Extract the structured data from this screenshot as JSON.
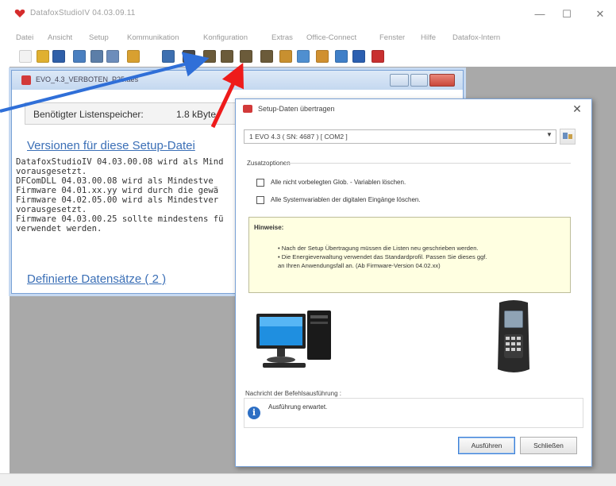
{
  "app": {
    "title": "DatafoxStudioIV 04.03.09.11",
    "window_buttons": {
      "minimize": "—",
      "maximize": "☐",
      "close": "✕"
    }
  },
  "menu": [
    "Datei",
    "Ansicht",
    "Setup",
    "Kommunikation",
    "Konfiguration",
    "Extras",
    "Office-Connect",
    "Fenster",
    "Hilfe",
    "Datafox-Intern"
  ],
  "toolbar": {
    "buttons": [
      {
        "icon": "new-icon",
        "color": "#f2f2f2"
      },
      {
        "icon": "open-folder-icon",
        "color": "#e0b030"
      },
      {
        "icon": "save-icon",
        "color": "#2f5fa8"
      },
      {
        "icon": "grid-icon",
        "color": "#4a7fc0"
      },
      {
        "icon": "table-icon",
        "color": "#5c7ea8"
      },
      {
        "icon": "sheet-icon",
        "color": "#6d8dbb"
      },
      {
        "icon": "device-icon",
        "color": "#d8a030"
      },
      {
        "icon": "undo-icon",
        "color": "#3d6fb0"
      },
      {
        "icon": "download-icon",
        "color": "#4a4a4a"
      },
      {
        "icon": "transfer-setup-icon",
        "color": "#6b5b3a"
      },
      {
        "icon": "transfer-firmware-icon",
        "color": "#6b5b3a"
      },
      {
        "icon": "transfer-lists-icon",
        "color": "#6b5b3a"
      },
      {
        "icon": "read-data-icon",
        "color": "#6b5b3a"
      },
      {
        "icon": "user-icon",
        "color": "#c89030"
      },
      {
        "icon": "clock-icon",
        "color": "#4f8fd0"
      },
      {
        "icon": "search-icon",
        "color": "#d09030"
      },
      {
        "icon": "chart-icon",
        "color": "#3f7fc8"
      },
      {
        "icon": "info-icon",
        "color": "#2b5fb0"
      },
      {
        "icon": "stop-icon",
        "color": "#c83030"
      }
    ]
  },
  "child_window": {
    "title": "EVO_4.3_VERBOTEN_P25.aes",
    "list_memory_label": "Benötigter Listenspeicher:",
    "list_memory_value": "1.8 kByte",
    "versions_heading": "Versionen für diese Setup-Datei",
    "lines": [
      "DatafoxStudioIV 04.03.00.08 wird als Mind",
      "vorausgesetzt.",
      "DFComDLL 04.03.00.08 wird als Mindestve",
      "Firmware 04.01.xx.yy wird durch die gewä",
      "Firmware 04.02.05.00 wird als Mindestver",
      "vorausgesetzt.",
      "Firmware 04.03.00.25 sollte mindestens fü",
      "verwendet werden."
    ],
    "records_heading": "Definierte Datensätze ( 2 )"
  },
  "dialog": {
    "title": "Setup-Daten übertragen",
    "close": "✕",
    "device_selected": "1  EVO 4.3 ( SN: 4687 ) [ COM2 ]",
    "options_label": "Zusatzoptionen",
    "option1": "Alle nicht vorbelegten Glob. - Variablen löschen.",
    "option2": "Alle Systemvariablen der digitalen Eingänge löschen.",
    "hint_title": "Hinweise:",
    "hint_lines": [
      "• Nach der Setup Übertragung müssen die Listen neu geschrieben werden.",
      "• Die Energieverwaltung verwendet das Standardprofil. Passen Sie dieses ggf.",
      "  an Ihren Anwendungsfall an. (Ab Firmware-Version 04.02.xx)"
    ],
    "message_label": "Nachricht der Befehlsausführung :",
    "message_text": "Ausführung erwartet.",
    "run_button": "Ausführen",
    "close_button": "Schließen"
  },
  "annotations": {
    "blue_arrow_color": "#2f6fd8",
    "red_arrow_color": "#ee1b1b"
  }
}
